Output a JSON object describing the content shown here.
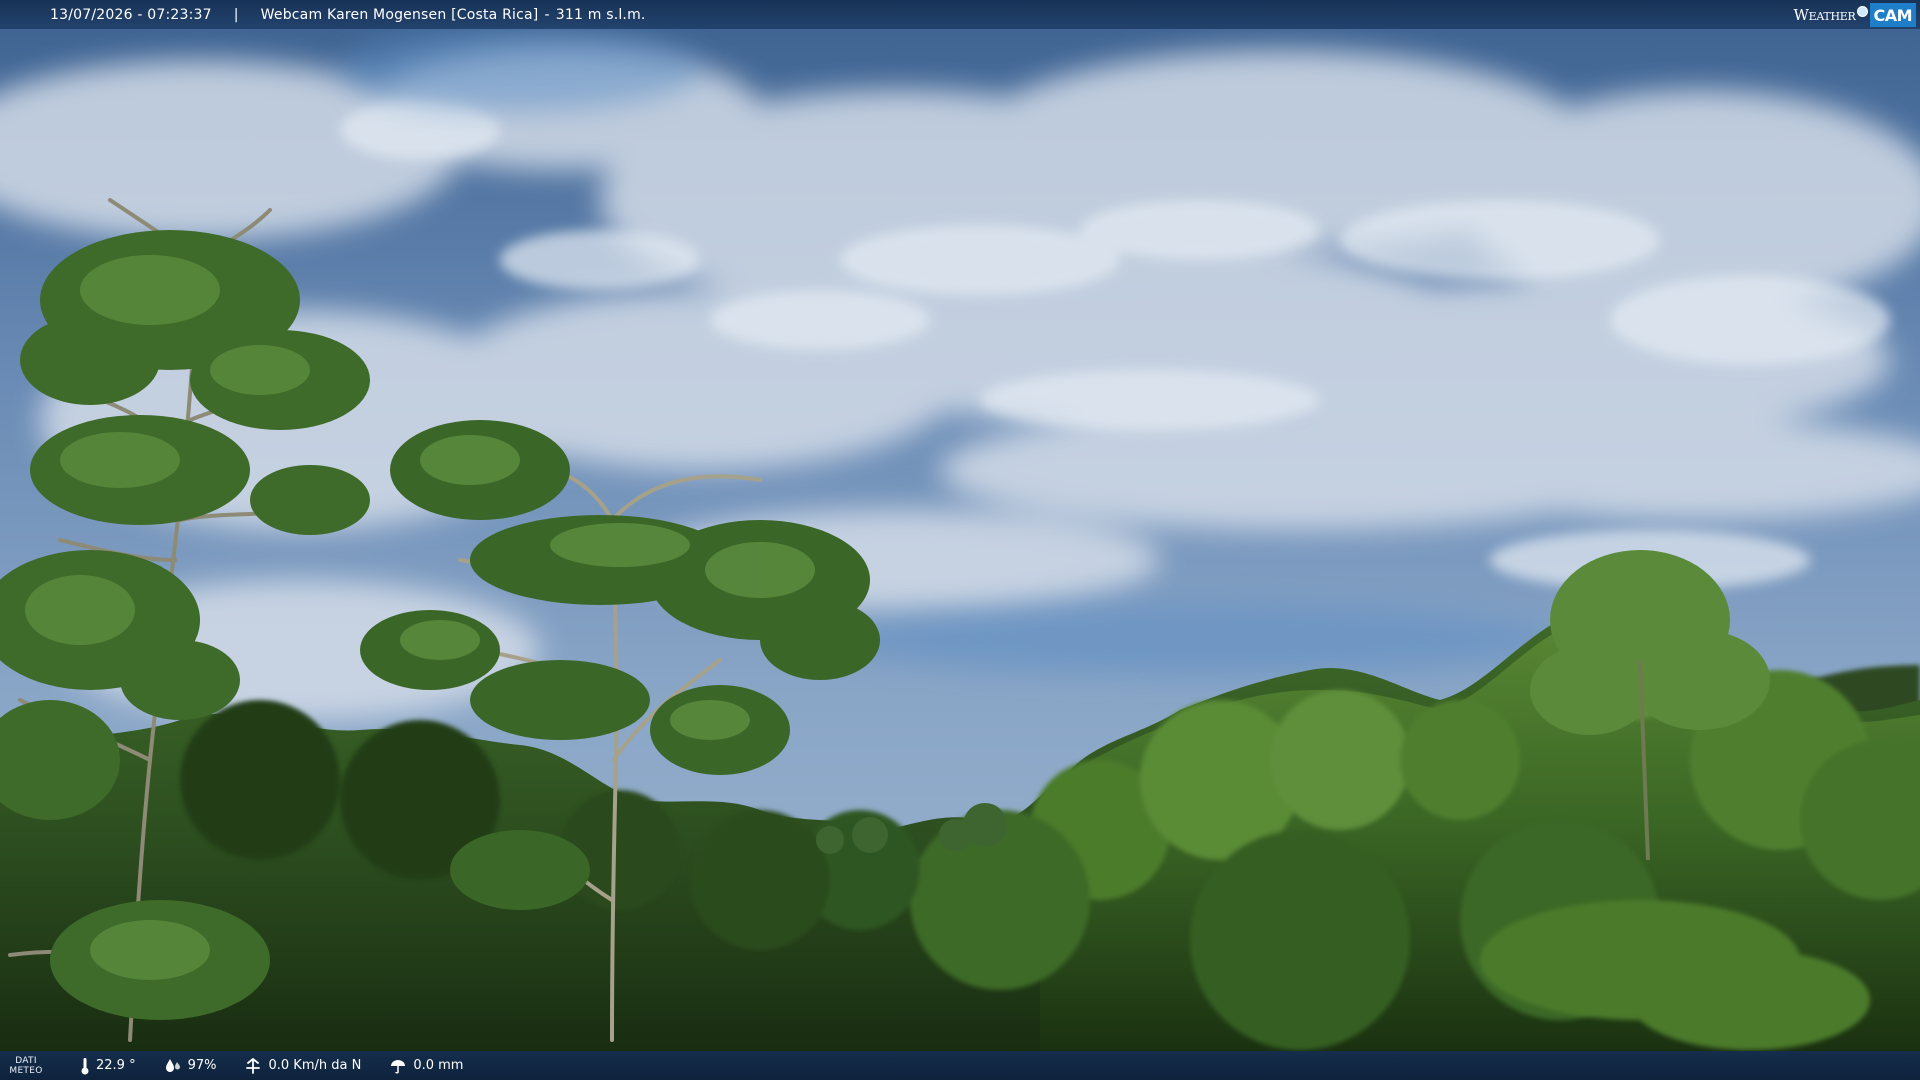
{
  "header": {
    "datetime": "13/07/2026 - 07:23:37",
    "separator": "|",
    "location": "Webcam Karen Mogensen [Costa Rica]",
    "elevation_separator": "-",
    "elevation": "311 m s.l.m."
  },
  "brand": {
    "weather_text": "Weather",
    "cam_text": "CAM"
  },
  "meteo": {
    "label_line1": "DATI",
    "label_line2": "METEO",
    "temperature": "22.9 °",
    "humidity": "97%",
    "wind": "0.0 Km/h da N",
    "rain": "0.0 mm",
    "icons": [
      "thermometer-icon",
      "humidity-drop-icon",
      "wind-icon",
      "rain-gauge-icon"
    ]
  },
  "colors": {
    "sky_top": "#3f6593",
    "sky_mid": "#7d9bc0",
    "cloud": "#cdd7e4",
    "foliage_dark": "#1f3a1a",
    "foliage_light": "#4d7a2e",
    "bar_bg": "#163054"
  }
}
